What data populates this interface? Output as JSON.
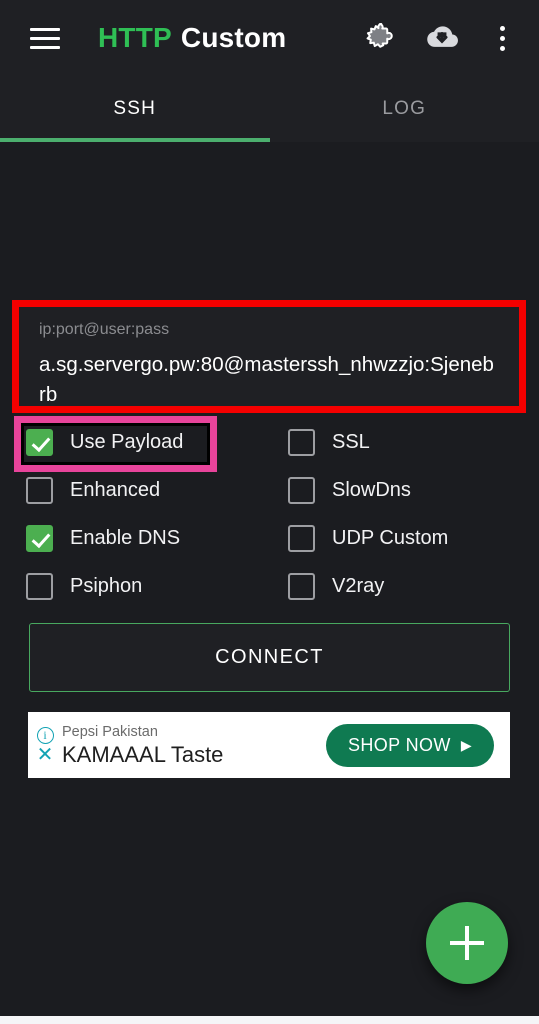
{
  "appbar": {
    "menu_icon": "hamburger-menu-icon",
    "title_primary": "HTTP",
    "title_secondary": "Custom",
    "brand_green": "#2fbf55",
    "actions": [
      {
        "name": "puzzle-icon",
        "label": "Plugin"
      },
      {
        "name": "cloud-download-icon",
        "label": "Download"
      },
      {
        "name": "overflow-menu-icon",
        "label": "More options"
      }
    ]
  },
  "tabs": {
    "items": [
      {
        "label": "SSH",
        "active": true
      },
      {
        "label": "LOG",
        "active": false
      }
    ],
    "indicator_color": "#4caf6e"
  },
  "host_field": {
    "label": "ip:port@user:pass",
    "value": "a.sg.servergo.pw:80@masterssh_nhwzzjo:Sjenebrb",
    "annotation_color": "#f40000"
  },
  "options": [
    {
      "label": "Use Payload",
      "checked": true,
      "annotated": true
    },
    {
      "label": "SSL",
      "checked": false,
      "annotated": false
    },
    {
      "label": "Enhanced",
      "checked": false,
      "annotated": false
    },
    {
      "label": "SlowDns",
      "checked": false,
      "annotated": false
    },
    {
      "label": "Enable DNS",
      "checked": true,
      "annotated": false
    },
    {
      "label": "UDP Custom",
      "checked": false,
      "annotated": false
    },
    {
      "label": "Psiphon",
      "checked": false,
      "annotated": false
    },
    {
      "label": "V2ray",
      "checked": false,
      "annotated": false
    }
  ],
  "annotations": {
    "payload_box_color": "#e8449b"
  },
  "connect_button": {
    "label": "CONNECT",
    "border_color": "#48a85f"
  },
  "ad": {
    "advertiser": "Pepsi Pakistan",
    "headline": "KAMAAAL Taste",
    "cta_label": "SHOP NOW",
    "cta_caret": "▶",
    "info_glyph": "i",
    "close_glyph": "✕",
    "cta_color": "#0f7a51"
  },
  "fab": {
    "icon": "plus-icon",
    "color": "#3fab54"
  }
}
